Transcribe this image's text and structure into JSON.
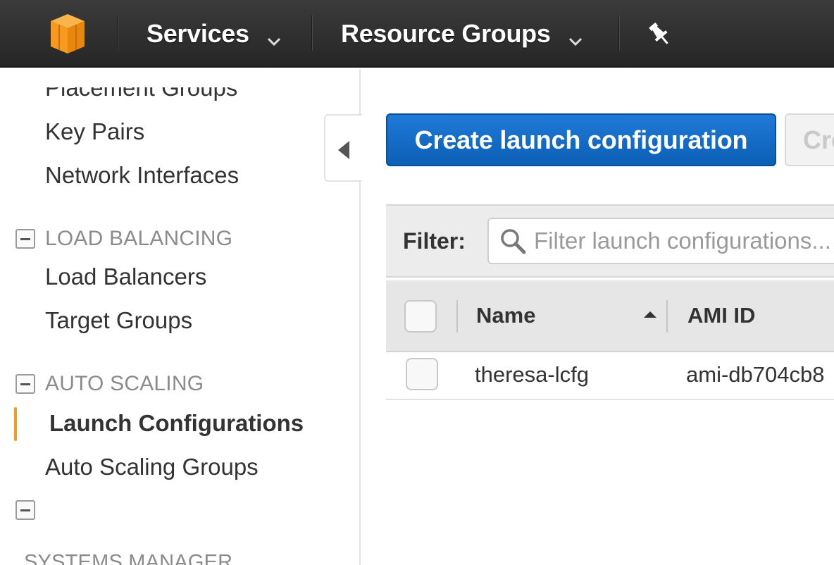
{
  "topnav": {
    "logo_icon": "aws-cube-icon",
    "services_label": "Services",
    "resource_groups_label": "Resource Groups",
    "pin_icon": "pushpin-icon",
    "brand_color": "#f79a1f"
  },
  "sidebar": {
    "placement_groups": "Placement Groups",
    "key_pairs": "Key Pairs",
    "network_interfaces": "Network Interfaces",
    "load_balancing_header": "LOAD BALANCING",
    "load_balancers": "Load Balancers",
    "target_groups": "Target Groups",
    "auto_scaling_header": "AUTO SCALING",
    "launch_configurations": "Launch Configurations",
    "auto_scaling_groups": "Auto Scaling Groups",
    "systems_manager_header": "SYSTEMS MANAGER"
  },
  "main": {
    "create_button": "Create launch configuration",
    "secondary_button": "Create",
    "filter_label": "Filter:",
    "filter_placeholder": "Filter launch configurations...",
    "columns": {
      "name": "Name",
      "ami_id": "AMI ID"
    },
    "rows": [
      {
        "name": "theresa-lcfg",
        "ami_id": "ami-db704cb8"
      }
    ]
  }
}
